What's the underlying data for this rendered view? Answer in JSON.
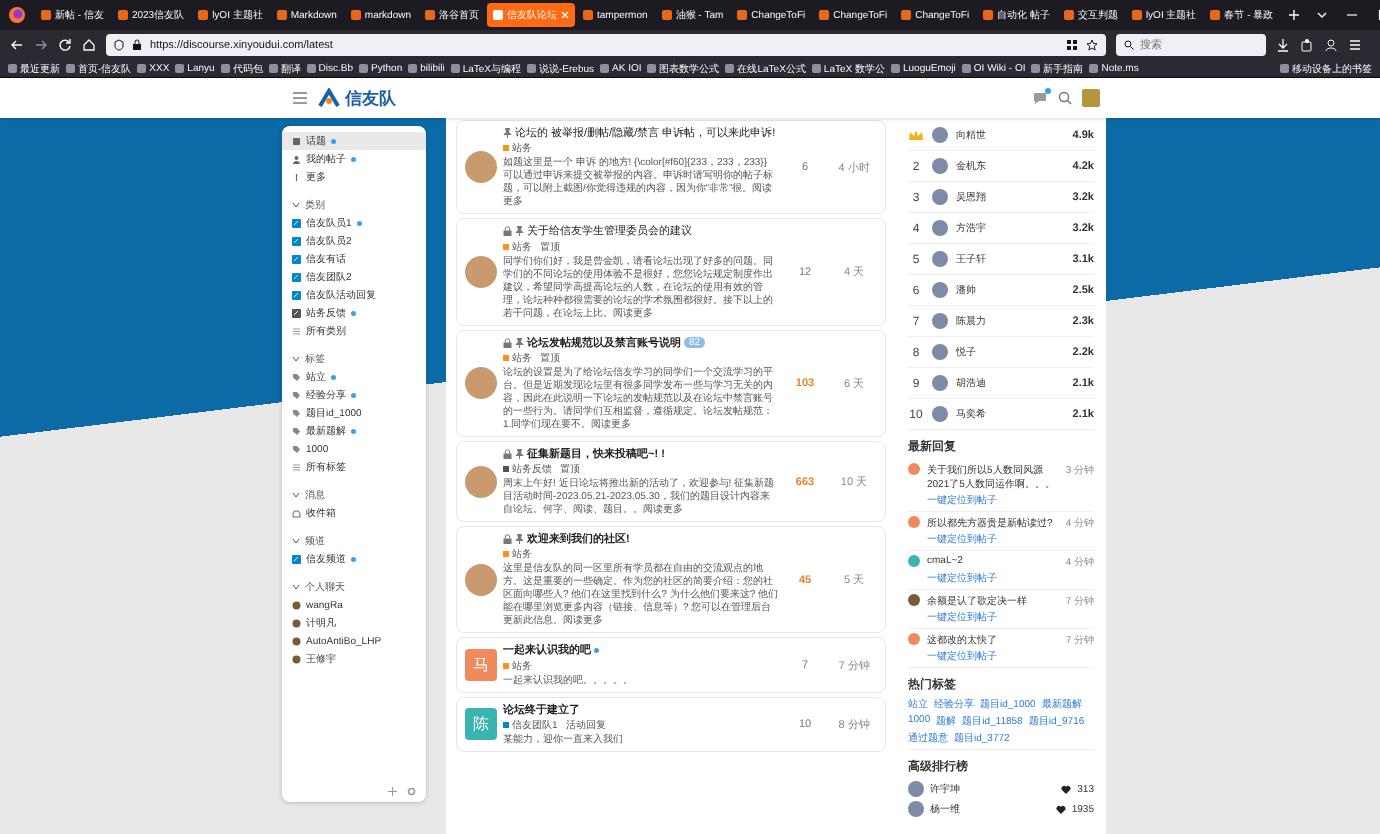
{
  "browser": {
    "tabs": [
      {
        "title": "新帖 - 信友",
        "selected": false
      },
      {
        "title": "2023信友队",
        "selected": false
      },
      {
        "title": "lyOI 主题社",
        "selected": false
      },
      {
        "title": "Markdown",
        "selected": false
      },
      {
        "title": "markdown",
        "selected": false
      },
      {
        "title": "洛谷首页",
        "selected": false
      },
      {
        "title": "信友队论坛",
        "selected": true
      },
      {
        "title": "tampermon",
        "selected": false
      },
      {
        "title": "油猴 - Tam",
        "selected": false
      },
      {
        "title": "ChangeToFi",
        "selected": false
      },
      {
        "title": "ChangeToFi",
        "selected": false
      },
      {
        "title": "ChangeToFi",
        "selected": false
      },
      {
        "title": "自动化 帖子",
        "selected": false
      },
      {
        "title": "交互判题",
        "selected": false
      },
      {
        "title": "lyOI 主题社",
        "selected": false
      },
      {
        "title": "春节 - 暴政",
        "selected": false
      }
    ],
    "address": "https://discourse.xinyoudui.com/latest",
    "search": {
      "placeholder": "搜索"
    },
    "bookmarks": [
      "最近更新",
      "首页-信友队",
      "XXX",
      "Lanyu",
      "代码包",
      "翻译",
      "Disc.Bb",
      "Python",
      "bilibili",
      "LaTeX与编程",
      "说说-Erebus",
      "AK IOI",
      "图表数学公式",
      "在线LaTeX公式",
      "LaTeX 数学公",
      "LuoguEmoji",
      "OI Wiki - OI",
      "新手指南",
      "Note.ms",
      "移动设备上的书签"
    ]
  },
  "site": {
    "logo": "信友队",
    "chat_unread": true
  },
  "sidebar": {
    "sections": [
      {
        "items": [
          {
            "kind": "topics",
            "label": "话题",
            "selected": true,
            "new": true
          },
          {
            "kind": "user",
            "label": "我的帖子",
            "selected": false,
            "new": true
          },
          {
            "kind": "more",
            "label": "更多",
            "selected": false,
            "new": false
          }
        ]
      },
      {
        "title": "类别",
        "expanded": true,
        "items": [
          {
            "kind": "category",
            "label": "信友队员1",
            "color": "#0088cc",
            "selected": false,
            "new": true
          },
          {
            "kind": "category",
            "label": "信友队员2",
            "color": "#0088cc",
            "selected": false,
            "new": false
          },
          {
            "kind": "category",
            "label": "信友有话",
            "color": "#0088cc",
            "selected": false,
            "new": false
          },
          {
            "kind": "category",
            "label": "信友团队2",
            "color": "#0088cc",
            "selected": false,
            "new": false
          },
          {
            "kind": "category",
            "label": "信友队活动回复",
            "color": "#0088cc",
            "selected": false,
            "new": false
          },
          {
            "kind": "category",
            "label": "站务反馈",
            "color": "#555555",
            "selected": false,
            "new": true
          },
          {
            "kind": "all",
            "label": "所有类别",
            "selected": false,
            "new": false
          }
        ]
      },
      {
        "title": "标签",
        "expanded": true,
        "items": [
          {
            "kind": "tag",
            "label": "站立",
            "selected": false,
            "new": true
          },
          {
            "kind": "tag",
            "label": "经验分享",
            "selected": false,
            "new": true
          },
          {
            "kind": "tag",
            "label": "题目id_1000",
            "selected": false,
            "new": false
          },
          {
            "kind": "tag",
            "label": "最新题解",
            "selected": false,
            "new": true
          },
          {
            "kind": "tag",
            "label": "1000",
            "selected": false,
            "new": false
          },
          {
            "kind": "all",
            "label": "所有标签",
            "selected": false,
            "new": false
          }
        ]
      },
      {
        "title": "消息",
        "expanded": true,
        "items": [
          {
            "kind": "inbox",
            "label": "收件箱",
            "selected": false,
            "new": false
          }
        ]
      },
      {
        "title": "频道",
        "expanded": true,
        "items": [
          {
            "kind": "category",
            "label": "信友频道",
            "color": "#0088cc",
            "selected": false,
            "new": true
          }
        ]
      },
      {
        "title": "个人聊天",
        "expanded": true,
        "items": [
          {
            "kind": "chat",
            "label": "wangRa",
            "selected": false,
            "new": false
          },
          {
            "kind": "chat",
            "label": "计明凡",
            "selected": false,
            "new": false
          },
          {
            "kind": "chat",
            "label": "AutoAntiBo_LHP",
            "selected": false,
            "new": false
          },
          {
            "kind": "chat",
            "label": "王修宇",
            "selected": false,
            "new": false
          }
        ]
      }
    ]
  },
  "topics": [
    {
      "title": "论坛的 被举报/删帖/隐藏/禁言 申诉帖，可以来此申诉!",
      "pinned": true,
      "locked": false,
      "visited": true,
      "avatar": {
        "kind": "photo"
      },
      "categories": [
        {
          "name": "站务",
          "color": "#f7941d"
        }
      ],
      "excerpt": "如题这里是一个 申诉 的地方! {\\color[#f60]{233，233，233}} 可以通过申诉来提交被举报的内容。申诉时请写明你的帖子标题，可以附上截图/你觉得违规的内容，因为你“非常”很。阅读更多",
      "replies": "6",
      "hot": false,
      "activity": "4 小时"
    },
    {
      "title": "关于给信友学生管理委员会的建议",
      "pinned": true,
      "locked": true,
      "visited": true,
      "avatar": {
        "kind": "photo"
      },
      "categories": [
        {
          "name": "站务",
          "color": "#f7941d"
        }
      ],
      "tags": [
        "置顶"
      ],
      "excerpt": "同学们你们好，我是曾金凯，请看论坛出现了好多的问题。同学们的不同论坛的使用体验不是很好，您您论坛规定制度作出建议，希望同学高提高论坛的人数，在论坛的使用有效的管理，论坛种种都很需要的论坛的学术氛围都很好。接下以上的若干问题，在论坛上比。阅读更多",
      "replies": "12",
      "hot": false,
      "activity": "4 天"
    },
    {
      "title": "论坛发帖规范以及禁言账号说明",
      "pinned": true,
      "locked": true,
      "visited": false,
      "badge": "82",
      "avatar": {
        "kind": "photo"
      },
      "categories": [
        {
          "name": "站务",
          "color": "#f7941d"
        }
      ],
      "tags": [
        "置顶"
      ],
      "excerpt": "论坛的设置是为了给论坛信友学习的同学们一个交流学习的平台。但是近期发现论坛里有很多同学发布一些与学习无关的内容，因此在此说明一下论坛的发帖规范以及在论坛中禁言账号的一些行为。请同学们互相监督，遵循规定。论坛发帖规范：1.同学们现在要不。阅读更多",
      "replies": "103",
      "hot": true,
      "activity": "6 天"
    },
    {
      "title": "征集新题目，快来投稿吧~! !",
      "pinned": true,
      "locked": true,
      "visited": false,
      "avatar": {
        "kind": "photo"
      },
      "categories": [
        {
          "name": "站务反馈",
          "color": "#555555"
        }
      ],
      "tags": [
        "置顶"
      ],
      "excerpt": "周末上午好! 近日论坛将推出新的活动了，欢迎参与! 征集新题目活动时间-2023.05.21-2023.05.30，我们的题目设计内容来自论坛。何字、阅读、题目。。阅读更多",
      "replies": "663",
      "hot": true,
      "activity": "10 天"
    },
    {
      "title": "欢迎来到我们的社区!",
      "pinned": true,
      "locked": true,
      "visited": false,
      "avatar": {
        "kind": "photo"
      },
      "categories": [
        {
          "name": "站务",
          "color": "#f7941d"
        }
      ],
      "excerpt": "这里是信友队的同一区里所有学员都在自由的交流观点的地方。这是重要的一些确定。作为您的社区的简要介绍：您的社区面向哪些人? 他们在这里找到什么? 为什么他们要来这? 他们能在哪里浏览更多内容（链接、信息等）? 您可以在管理后台更新此信息。阅读更多",
      "replies": "45",
      "hot": true,
      "activity": "5 天"
    },
    {
      "title": "一起来认识我的吧",
      "pinned": false,
      "locked": false,
      "visited": false,
      "new": true,
      "avatar": {
        "kind": "letter",
        "letter": "马",
        "color": "#f08a5d"
      },
      "categories": [
        {
          "name": "站务",
          "color": "#f7941d"
        }
      ],
      "excerpt": "一起来认识我的吧。。。。。",
      "replies": "7",
      "hot": false,
      "activity": "7 分钟"
    },
    {
      "title": "论坛终于建立了",
      "pinned": false,
      "locked": false,
      "visited": false,
      "avatar": {
        "kind": "letter",
        "letter": "陈",
        "color": "#3ab4b0"
      },
      "categories": [
        {
          "name": "信友团队1",
          "color": "#0088cc"
        }
      ],
      "tags": [
        "活动回复"
      ],
      "excerpt": "某能力，迎你一直来入我们",
      "replies": "10",
      "hot": false,
      "activity": "8 分钟"
    }
  ],
  "leaderboard": [
    {
      "crown": true,
      "name": "向精世",
      "score": "4.9k"
    },
    {
      "rank": "2",
      "crown": false,
      "name": "金机东",
      "score": "4.2k"
    },
    {
      "rank": "3",
      "crown": false,
      "name": "吴恩翔",
      "score": "3.2k"
    },
    {
      "rank": "4",
      "crown": false,
      "name": "方浩宇",
      "score": "3.2k"
    },
    {
      "rank": "5",
      "crown": false,
      "name": "王子轩",
      "score": "3.1k"
    },
    {
      "rank": "6",
      "crown": false,
      "name": "潘帅",
      "score": "2.5k"
    },
    {
      "rank": "7",
      "crown": false,
      "name": "陈晨力",
      "score": "2.3k"
    },
    {
      "rank": "8",
      "crown": false,
      "name": "悦子",
      "score": "2.2k"
    },
    {
      "rank": "9",
      "crown": false,
      "name": "胡浩迪",
      "score": "2.1k"
    },
    {
      "rank": "10",
      "crown": false,
      "name": "马奕希",
      "score": "2.1k"
    }
  ],
  "recent_replies": {
    "title": "最新回复",
    "items": [
      {
        "text": "关于我们所以5人数同风源2021了5人数同运作啊。。。",
        "time": "3 分钟",
        "link": "一键定位到帖子",
        "color": "#f08a5d"
      },
      {
        "text": "所以都先方器贵是新帖读过?",
        "time": "4 分钟",
        "link": "一键定位到帖子",
        "color": "#f08a5d"
      },
      {
        "text": "cmaL~2",
        "time": "4 分钟",
        "link": "一键定位到帖子",
        "color": "#3ab4b0"
      },
      {
        "text": "余额是认了歌定决一样",
        "time": "7 分钟",
        "link": "一键定位到帖子",
        "color": "#7a5a3a"
      },
      {
        "text": "这都改的太快了",
        "time": "7 分钟",
        "link": "一键定位到帖子",
        "color": "#f08a5d"
      }
    ]
  },
  "hot_tags": {
    "title": "热门标签",
    "tags": [
      "站立",
      "经验分享",
      "题目id_1000",
      "最新题解",
      "1000",
      "题解",
      "题目id_11858",
      "题目id_9716",
      "通过题意",
      "题目id_3772"
    ]
  },
  "ranking": {
    "title": "高级排行榜",
    "items": [
      {
        "name": "许宇坤",
        "count": "313"
      },
      {
        "name": "杨一维",
        "count": "1935"
      }
    ]
  }
}
